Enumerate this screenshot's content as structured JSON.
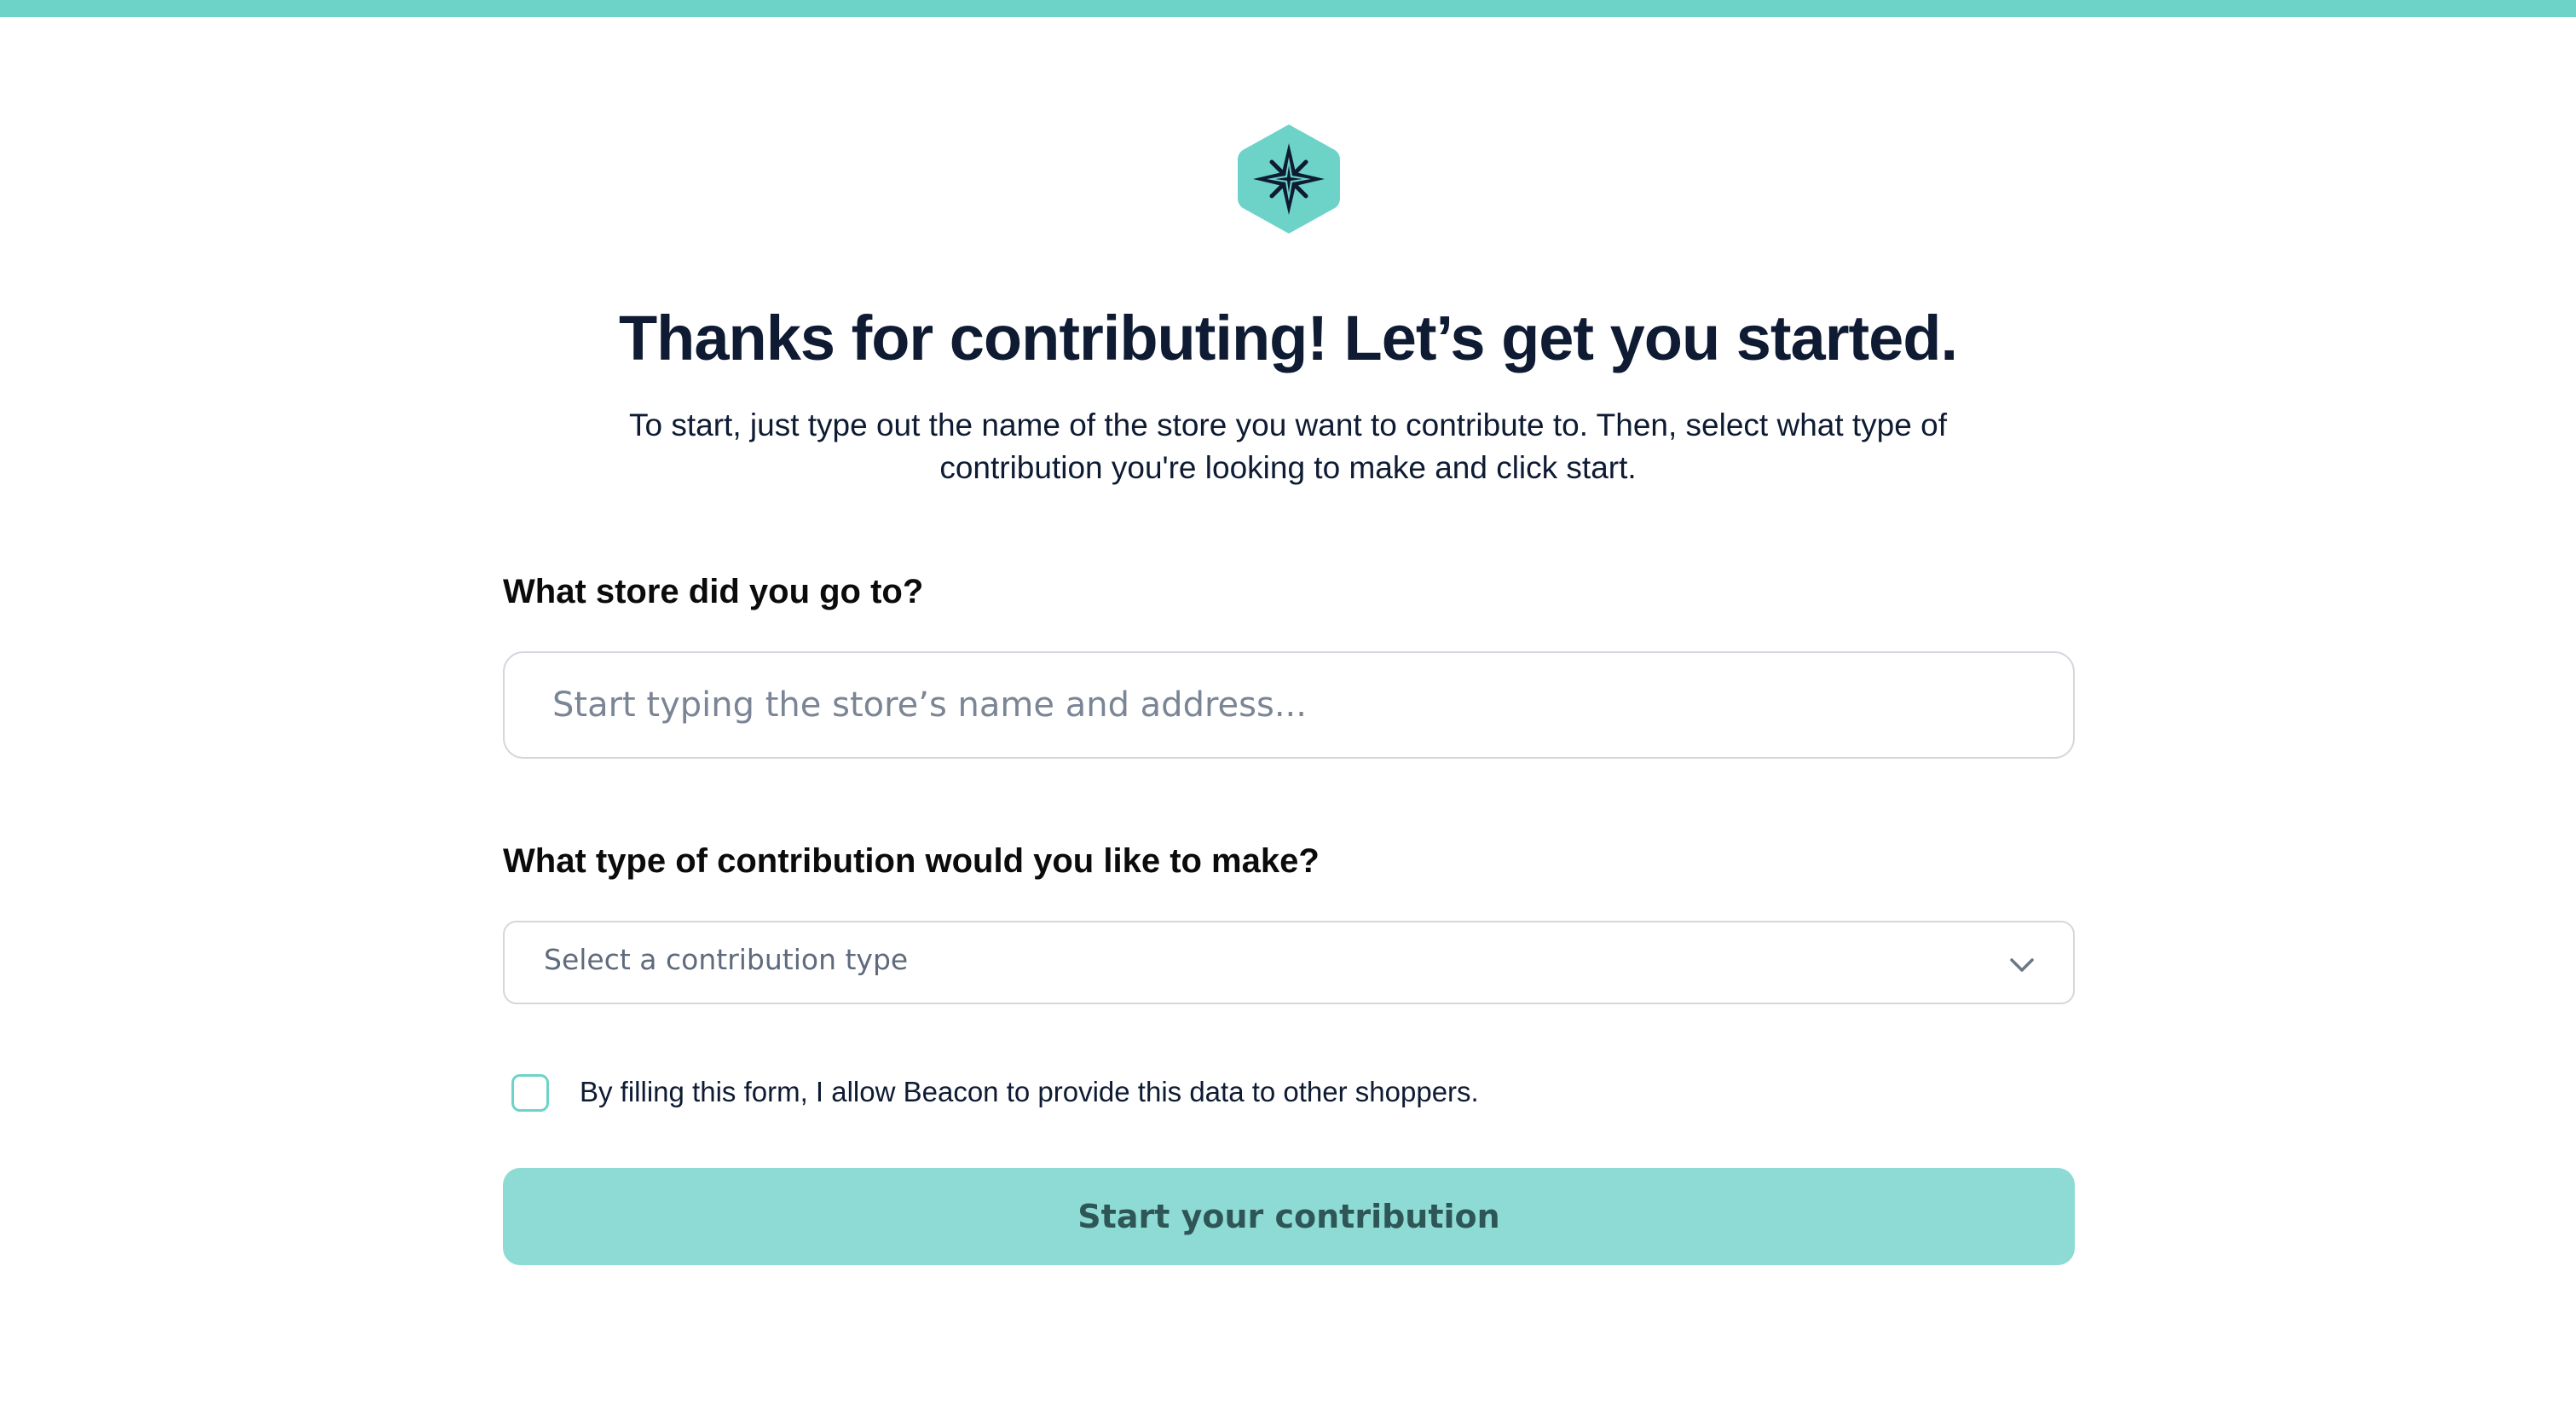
{
  "brand": {
    "name": "Beacon",
    "accent_color": "#6dd3c9",
    "logo_icon": "compass-star-icon"
  },
  "header": {
    "title": "Thanks for contributing! Let’s get you started.",
    "subtitle": "To start, just type out the name of the store you want to contribute to. Then, select what type of contribution you're looking to make and click start."
  },
  "form": {
    "store": {
      "label": "What store did you go to?",
      "value": "",
      "placeholder": "Start typing the store’s name and address..."
    },
    "contribution_type": {
      "label": "What type of contribution would you like to make?",
      "selected": "Select a contribution type",
      "icon": "chevron-down-icon"
    },
    "consent": {
      "checked": false,
      "text": "By filling this form, I allow Beacon to provide this data to other shoppers."
    },
    "submit_label": "Start your contribution"
  }
}
